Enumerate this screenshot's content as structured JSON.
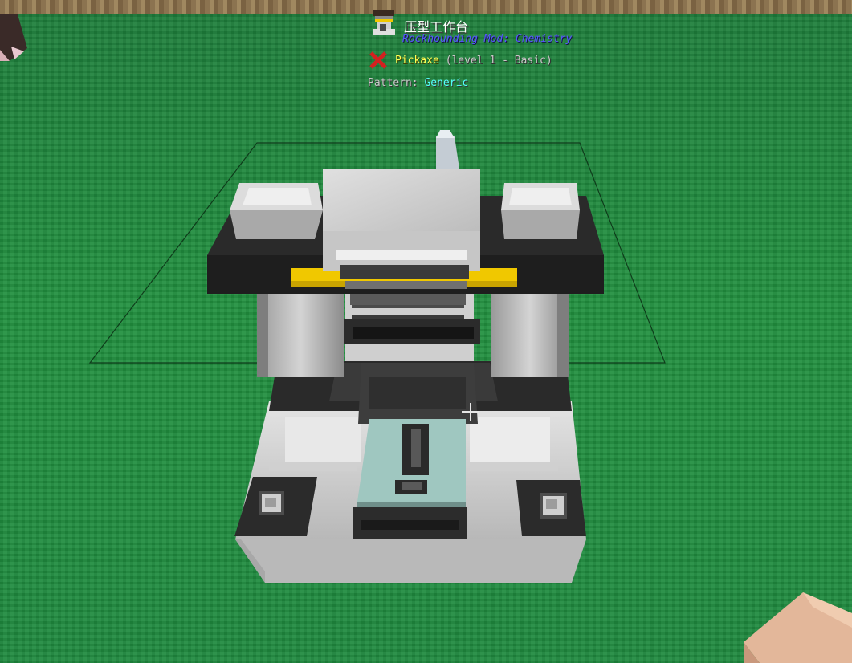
{
  "colors": {
    "grass": "#1f8a3f",
    "title_text": "#ffffff",
    "mod_name_text": "#5555ff",
    "tool_name_text": "#ffff55",
    "tool_level_text": "#c8c8c8",
    "pattern_label_text": "#c8c8c8",
    "pattern_value_text": "#55ffff",
    "harvest_fail_icon": "#d42020",
    "machine_accent": "#f0c800"
  },
  "hud": {
    "block_icon": "press-workbench-icon",
    "title": "压型工作台",
    "mod_name": "Rockhounding Mod: Chemistry",
    "harvest_icon": "red-x-icon",
    "tool_name": "Pickaxe",
    "tool_level": "(level 1 - Basic)",
    "pattern_label": "Pattern:",
    "pattern_value": "Generic"
  },
  "world": {
    "target_block": "press-workbench-machine",
    "ground": "grass-blocks",
    "player_hand": "player-hand"
  }
}
